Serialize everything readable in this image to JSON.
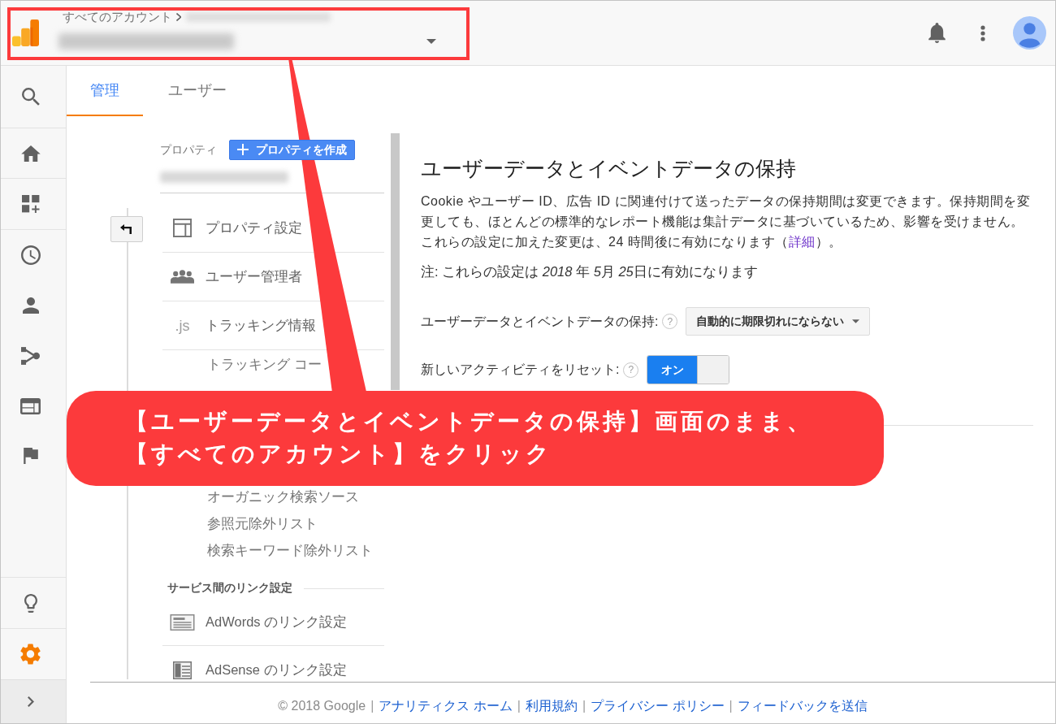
{
  "header": {
    "breadcrumb": "すべてのアカウント"
  },
  "sidebar": {
    "items": [
      {
        "selected": false
      },
      {
        "selected": false
      },
      {
        "selected": false
      },
      {
        "selected": false
      },
      {
        "selected": false
      },
      {
        "selected": false
      },
      {
        "selected": false
      },
      {
        "selected": false
      }
    ],
    "bottom_items": [
      {
        "selected": false
      },
      {
        "selected": true
      }
    ]
  },
  "tabs": [
    {
      "label": "管理",
      "selected": true
    },
    {
      "label": "ユーザー",
      "selected": false
    }
  ],
  "property_panel": {
    "label": "プロパティ",
    "create_button": "プロパティを作成",
    "items": [
      {
        "kind": "link",
        "label": "プロパティ設定"
      },
      {
        "kind": "link",
        "label": "ユーザー管理者"
      },
      {
        "kind": "link",
        "icon_text": ".js",
        "label": "トラッキング情報",
        "children": [
          {
            "label": "トラッキング コー"
          },
          {
            "label": "オーガニック検索ソース"
          },
          {
            "label": "参照元除外リスト"
          },
          {
            "label": "検索キーワード除外リスト"
          }
        ]
      },
      {
        "kind": "heading",
        "label": "サービス間のリンク設定"
      },
      {
        "kind": "link",
        "label": "AdWords のリンク設定"
      },
      {
        "kind": "link",
        "label": "AdSense のリンク設定"
      }
    ]
  },
  "content": {
    "title": "ユーザーデータとイベントデータの保持",
    "description": {
      "text": "Cookie やユーザー ID、広告 ID に関連付けて送ったデータの保持期間は変更できます。保持期間を変更しても、ほとんどの標準的なレポート機能は集計データに基づいているため、影響を受けません。これらの設定に加えた変更は、24 時間後に有効になります（",
      "link": "詳細",
      "text_end": "）。"
    },
    "note": {
      "parts": [
        {
          "text": "注: これらの設定は ",
          "italic": false
        },
        {
          "text": "2018",
          "italic": true
        },
        {
          "text": " 年 ",
          "italic": false
        },
        {
          "text": "5",
          "italic": true
        },
        {
          "text": "月 ",
          "italic": false
        },
        {
          "text": "25",
          "italic": true
        },
        {
          "text": "日に有効になります",
          "italic": false
        }
      ]
    },
    "settings": [
      {
        "kind": "dropdown",
        "label": "ユーザーデータとイベントデータの保持:",
        "help": "?",
        "value": "自動的に期限切れにならない"
      },
      {
        "kind": "toggle",
        "label": "新しいアクティビティをリセット:",
        "help": "?",
        "on": true,
        "state_label": "オン"
      }
    ]
  },
  "footer": [
    {
      "kind": "text",
      "text": "© 2018 Google"
    },
    {
      "kind": "separator",
      "text": "|"
    },
    {
      "kind": "link",
      "text": "アナリティクス ホーム"
    },
    {
      "kind": "separator",
      "text": "|"
    },
    {
      "kind": "link",
      "text": "利用規約"
    },
    {
      "kind": "separator",
      "text": "|"
    },
    {
      "kind": "link",
      "text": "プライバシー ポリシー"
    },
    {
      "kind": "separator",
      "text": "|"
    },
    {
      "kind": "link",
      "text": "フィードバックを送信"
    }
  ],
  "callout": {
    "lines": [
      "【ユーザーデータとイベントデータの保持】画面のまま、",
      "【すべてのアカウント】をクリック"
    ]
  }
}
